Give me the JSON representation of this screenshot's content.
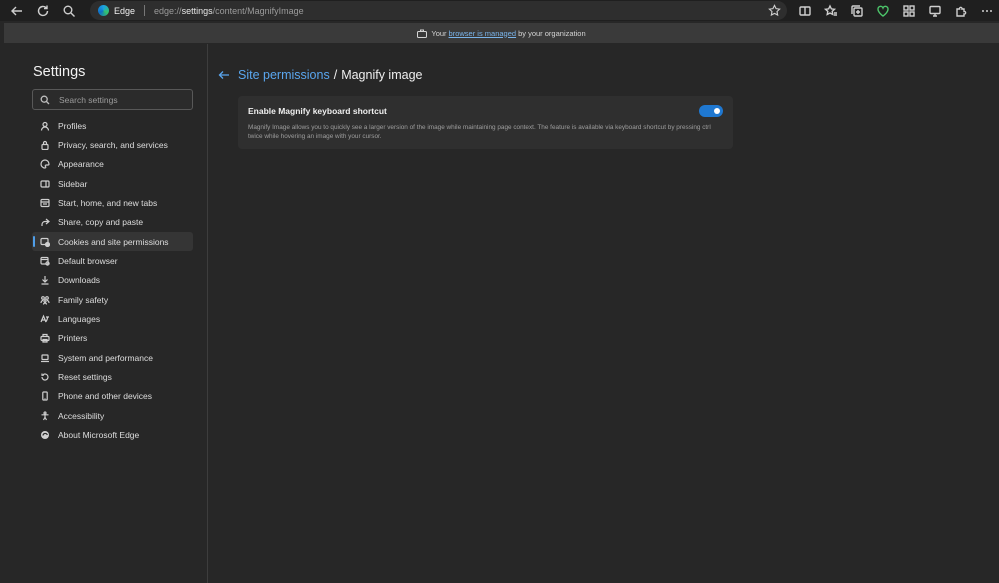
{
  "browser": {
    "site_label": "Edge",
    "url_prefix": "edge://",
    "url_host": "settings",
    "url_path": "/content/MagnifyImage"
  },
  "managed_bar": {
    "prefix": "Your",
    "link": "browser is managed",
    "suffix": "by your organization"
  },
  "sidebar": {
    "title": "Settings",
    "search_placeholder": "Search settings",
    "items": [
      {
        "label": "Profiles",
        "icon": "profile-icon"
      },
      {
        "label": "Privacy, search, and services",
        "icon": "lock-icon"
      },
      {
        "label": "Appearance",
        "icon": "palette-icon"
      },
      {
        "label": "Sidebar",
        "icon": "sidebar-icon"
      },
      {
        "label": "Start, home, and new tabs",
        "icon": "home-icon"
      },
      {
        "label": "Share, copy and paste",
        "icon": "share-icon"
      },
      {
        "label": "Cookies and site permissions",
        "icon": "cookies-icon"
      },
      {
        "label": "Default browser",
        "icon": "browser-icon"
      },
      {
        "label": "Downloads",
        "icon": "download-icon"
      },
      {
        "label": "Family safety",
        "icon": "family-icon"
      },
      {
        "label": "Languages",
        "icon": "language-icon"
      },
      {
        "label": "Printers",
        "icon": "printer-icon"
      },
      {
        "label": "System and performance",
        "icon": "laptop-icon"
      },
      {
        "label": "Reset settings",
        "icon": "reset-icon"
      },
      {
        "label": "Phone and other devices",
        "icon": "phone-icon"
      },
      {
        "label": "Accessibility",
        "icon": "accessibility-icon"
      },
      {
        "label": "About Microsoft Edge",
        "icon": "edge-icon"
      }
    ],
    "active_index": 6
  },
  "breadcrumb": {
    "parent": "Site permissions",
    "separator": "/",
    "current": "Magnify image"
  },
  "setting": {
    "title": "Enable Magnify keyboard shortcut",
    "description": "Magnify Image allows you to quickly see a larger version of the image while maintaining page context. The feature is available via keyboard shortcut by pressing ctrl twice while hovering an image with your cursor.",
    "enabled": true
  },
  "colors": {
    "accent": "#5aa6ee",
    "toggle_on": "#1f78d1",
    "background": "#272727"
  }
}
